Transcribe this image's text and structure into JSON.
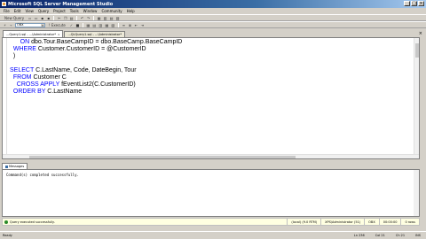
{
  "window": {
    "title": "Microsoft SQL Server Management Studio",
    "buttons": [
      "_",
      "□",
      "×"
    ]
  },
  "menu": [
    "File",
    "Edit",
    "View",
    "Query",
    "Project",
    "Tools",
    "Window",
    "Community",
    "Help"
  ],
  "toolbar": {
    "new_query": "New Query",
    "database": "OBX",
    "execute": "! Execute"
  },
  "doc_tabs": [
    {
      "label": "...Query1.sql - ...\\Administrator*",
      "active": true
    },
    {
      "label": "...QLQuery1.sql - ...\\Administrator*",
      "active": false
    }
  ],
  "editor": {
    "lines": [
      [
        {
          "t": "      ON ",
          "c": "kw"
        },
        {
          "t": "dbo.Tour.BaseCampID = dbo.BaseCamp.BaseCampID",
          "c": "id"
        }
      ],
      [
        {
          "t": "  WHERE ",
          "c": "kw"
        },
        {
          "t": "Customer.CustomerID = @CustomerID",
          "c": "id"
        }
      ],
      [
        {
          "t": "  )",
          "c": "id"
        }
      ],
      [
        {
          "t": "",
          "c": "id"
        }
      ],
      [
        {
          "t": "SELECT ",
          "c": "kw"
        },
        {
          "t": "C.LastName, Code, DateBegin, Tour",
          "c": "id"
        }
      ],
      [
        {
          "t": "  FROM ",
          "c": "kw"
        },
        {
          "t": "Customer C",
          "c": "id"
        }
      ],
      [
        {
          "t": "    CROSS APPLY ",
          "c": "kw"
        },
        {
          "t": "fEventList2(C.CustomerID)",
          "c": "id"
        }
      ],
      [
        {
          "t": "  ORDER BY ",
          "c": "kw"
        },
        {
          "t": "C.LastName",
          "c": "id"
        }
      ]
    ]
  },
  "results": {
    "tab": "Messages",
    "message": "Command(s) completed successfully."
  },
  "query_status": {
    "text": "Query executed successfully.",
    "server": "(local) (9.0 RTM)",
    "login": "XPS\\Administrator (51)",
    "database": "OBX",
    "time": "00:00:00",
    "rows": "0 rows"
  },
  "statusbar": {
    "ready": "Ready",
    "ln": "Ln 236",
    "col": "Col 21",
    "ch": "Ch 21",
    "mode": "INS"
  }
}
